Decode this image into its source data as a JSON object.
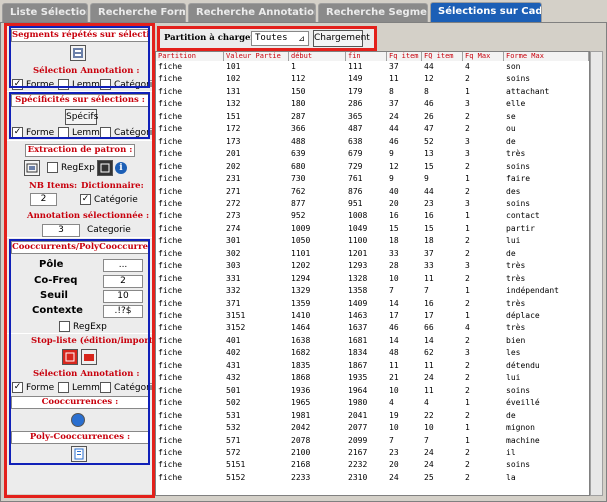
{
  "tabs": [
    {
      "label": "Liste Sélections",
      "active": false
    },
    {
      "label": "Recherche Forme",
      "active": false
    },
    {
      "label": "Recherche Annotation(s)",
      "active": false
    },
    {
      "label": "Recherche Segments",
      "active": false
    },
    {
      "label": "Sélections sur Cadre",
      "active": true
    }
  ],
  "left": {
    "segments_title": "Segments répétés sur sélections :",
    "selection_annotation": "Sélection Annotation :",
    "chk_forme": "Forme",
    "chk_lemme": "Lemme",
    "chk_categorie": "Catégorie",
    "specificites_title": "Spécificités sur sélections :",
    "specifs_button": "Spécifs",
    "extraction_title": "Extraction de patron :",
    "regexp": "RegExp",
    "nb_items_label": "NB Items:",
    "dictionnaire_label": "Dictionnaire:",
    "nb_items_value": "2",
    "dict_categorie": "Catégorie",
    "annotation_selectionnee": "Annotation sélectionnée :",
    "annotation_value": "3",
    "annotation_categorie": "Categorie",
    "cooccurrents_title": "Cooccurrents/PolyCooccurrents :",
    "pole_label": "Pôle",
    "pole_value": "...",
    "cofreq_label": "Co-Freq",
    "cofreq_value": "2",
    "seuil_label": "Seuil",
    "seuil_value": "10",
    "contexte_label": "Contexte",
    "contexte_value": ".!?$",
    "regexp2": "RegExp",
    "stopliste_title": "Stop-liste (édition/import)",
    "selection_annotation2": "Sélection Annotation :",
    "cooccurrences_title": "Cooccurrences :",
    "polycooccurrences_title": "Poly-Cooccurrences :"
  },
  "toolbar": {
    "partition_label": "Partition à charger :",
    "partition_value": "Toutes",
    "chargement_button": "Chargement"
  },
  "grid": {
    "headers": [
      "Partition",
      "Valeur Partie",
      "début",
      "fin",
      "Fq item",
      "FQ item",
      "Fq Max",
      "Forme Max"
    ],
    "rows": [
      [
        "fiche",
        "101",
        "1",
        "111",
        "37",
        "44",
        "4",
        "son"
      ],
      [
        "fiche",
        "102",
        "112",
        "149",
        "11",
        "12",
        "2",
        "soins"
      ],
      [
        "fiche",
        "131",
        "150",
        "179",
        "8",
        "8",
        "1",
        "attachant"
      ],
      [
        "fiche",
        "132",
        "180",
        "286",
        "37",
        "46",
        "3",
        "elle"
      ],
      [
        "fiche",
        "151",
        "287",
        "365",
        "24",
        "26",
        "2",
        "se"
      ],
      [
        "fiche",
        "172",
        "366",
        "487",
        "44",
        "47",
        "2",
        "ou"
      ],
      [
        "fiche",
        "173",
        "488",
        "638",
        "46",
        "52",
        "3",
        "de"
      ],
      [
        "fiche",
        "201",
        "639",
        "679",
        "9",
        "13",
        "3",
        "très"
      ],
      [
        "fiche",
        "202",
        "680",
        "729",
        "12",
        "15",
        "2",
        "soins"
      ],
      [
        "fiche",
        "231",
        "730",
        "761",
        "9",
        "9",
        "1",
        "faire"
      ],
      [
        "fiche",
        "271",
        "762",
        "876",
        "40",
        "44",
        "2",
        "des"
      ],
      [
        "fiche",
        "272",
        "877",
        "951",
        "20",
        "23",
        "3",
        "soins"
      ],
      [
        "fiche",
        "273",
        "952",
        "1008",
        "16",
        "16",
        "1",
        "contact"
      ],
      [
        "fiche",
        "274",
        "1009",
        "1049",
        "15",
        "15",
        "1",
        "partir"
      ],
      [
        "fiche",
        "301",
        "1050",
        "1100",
        "18",
        "18",
        "2",
        "lui"
      ],
      [
        "fiche",
        "302",
        "1101",
        "1201",
        "33",
        "37",
        "2",
        "de"
      ],
      [
        "fiche",
        "303",
        "1202",
        "1293",
        "28",
        "33",
        "3",
        "très"
      ],
      [
        "fiche",
        "331",
        "1294",
        "1328",
        "10",
        "11",
        "2",
        "très"
      ],
      [
        "fiche",
        "332",
        "1329",
        "1358",
        "7",
        "7",
        "1",
        "indépendant"
      ],
      [
        "fiche",
        "371",
        "1359",
        "1409",
        "14",
        "16",
        "2",
        "très"
      ],
      [
        "fiche",
        "3151",
        "1410",
        "1463",
        "17",
        "17",
        "1",
        "déplace"
      ],
      [
        "fiche",
        "3152",
        "1464",
        "1637",
        "46",
        "66",
        "4",
        "très"
      ],
      [
        "fiche",
        "401",
        "1638",
        "1681",
        "14",
        "14",
        "2",
        "bien"
      ],
      [
        "fiche",
        "402",
        "1682",
        "1834",
        "48",
        "62",
        "3",
        "les"
      ],
      [
        "fiche",
        "431",
        "1835",
        "1867",
        "11",
        "11",
        "2",
        "détendu"
      ],
      [
        "fiche",
        "432",
        "1868",
        "1935",
        "21",
        "24",
        "2",
        "lui"
      ],
      [
        "fiche",
        "501",
        "1936",
        "1964",
        "10",
        "11",
        "2",
        "soins"
      ],
      [
        "fiche",
        "502",
        "1965",
        "1980",
        "4",
        "4",
        "1",
        "éveillé"
      ],
      [
        "fiche",
        "531",
        "1981",
        "2041",
        "19",
        "22",
        "2",
        "de"
      ],
      [
        "fiche",
        "532",
        "2042",
        "2077",
        "10",
        "10",
        "1",
        "mignon"
      ],
      [
        "fiche",
        "571",
        "2078",
        "2099",
        "7",
        "7",
        "1",
        "machine"
      ],
      [
        "fiche",
        "572",
        "2100",
        "2167",
        "23",
        "24",
        "2",
        "il"
      ],
      [
        "fiche",
        "5151",
        "2168",
        "2232",
        "20",
        "24",
        "2",
        "soins"
      ],
      [
        "fiche",
        "5152",
        "2233",
        "2310",
        "24",
        "25",
        "2",
        "la"
      ]
    ]
  }
}
